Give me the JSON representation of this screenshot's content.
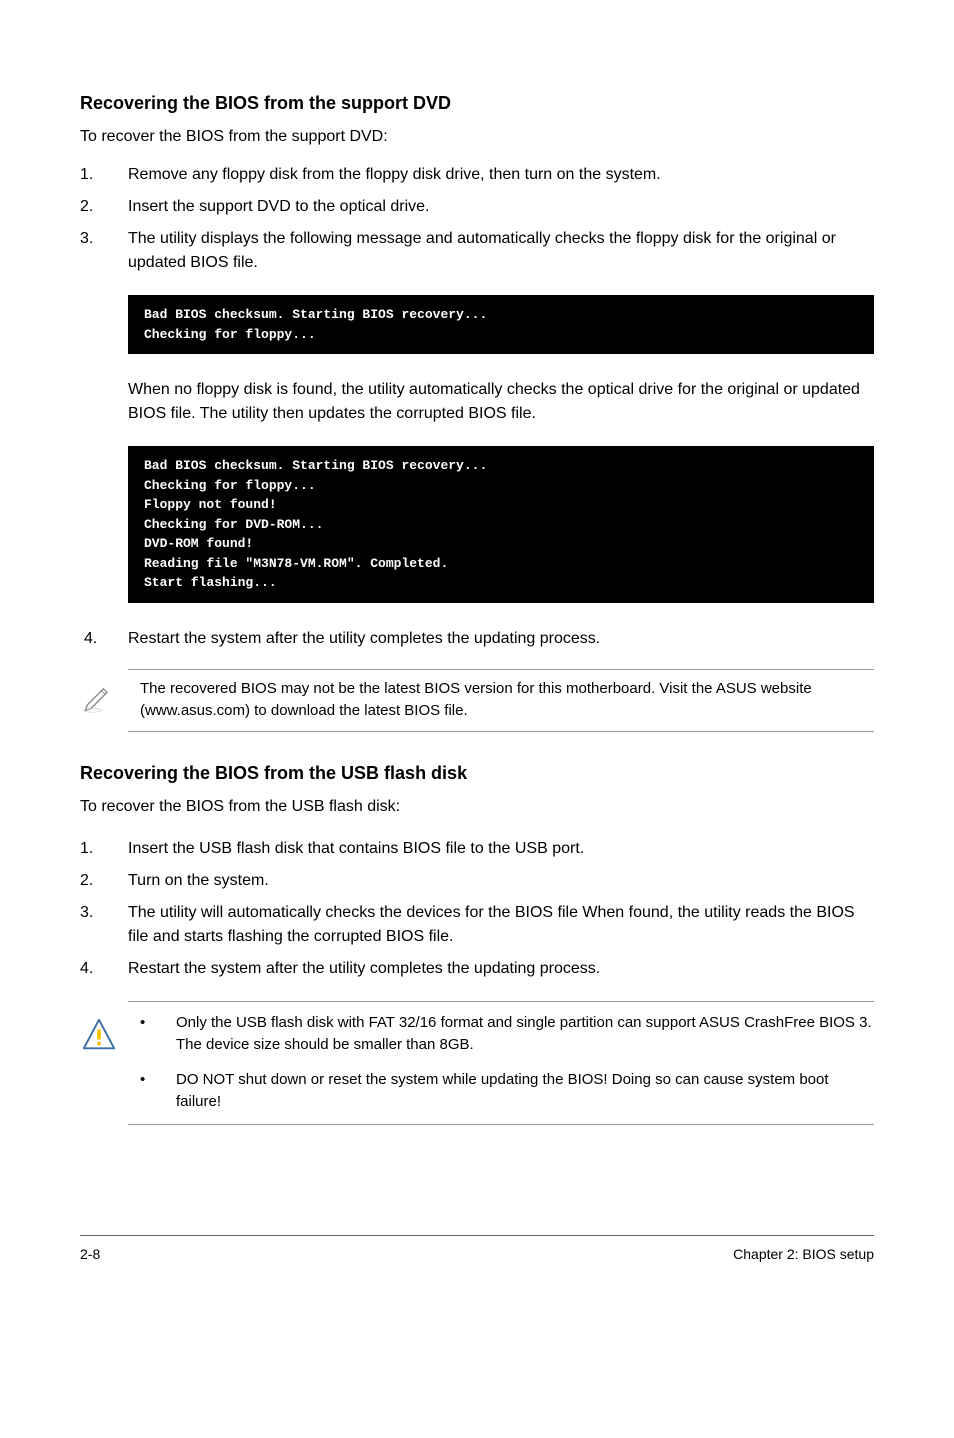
{
  "section1": {
    "heading": "Recovering the BIOS from the support DVD",
    "intro": "To recover the BIOS from the support DVD:",
    "steps": [
      {
        "num": "1.",
        "text": "Remove any floppy disk from the floppy disk drive, then turn on the system."
      },
      {
        "num": "2.",
        "text": "Insert the support DVD to the optical drive."
      },
      {
        "num": "3.",
        "text": "The utility displays the following message and automatically checks the floppy disk for the original or updated BIOS file."
      }
    ],
    "code1": "Bad BIOS checksum. Starting BIOS recovery...\nChecking for floppy...",
    "para1": "When no floppy disk is found, the utility automatically checks the optical drive for the original or updated BIOS file. The utility then updates the corrupted BIOS file.",
    "code2": "Bad BIOS checksum. Starting BIOS recovery...\nChecking for floppy...\nFloppy not found!\nChecking for DVD-ROM...\nDVD-ROM found!\nReading file \"M3N78-VM.ROM\". Completed.\nStart flashing...",
    "step4": {
      "num": "4.",
      "text": "Restart the system after the utility completes the updating process."
    },
    "note": "The recovered BIOS may not be the latest BIOS version for this motherboard. Visit the ASUS website (www.asus.com) to download the latest BIOS file."
  },
  "section2": {
    "heading": "Recovering the BIOS from the USB flash disk",
    "intro": "To recover the BIOS from the USB flash disk:",
    "steps": [
      {
        "num": "1.",
        "text": "Insert the USB flash disk that contains BIOS file to the USB port."
      },
      {
        "num": "2.",
        "text": "Turn on the system."
      },
      {
        "num": "3.",
        "text": "The utility will automatically checks the devices for the BIOS file When found, the utility reads the BIOS file and starts flashing the corrupted BIOS file."
      },
      {
        "num": "4.",
        "text": "Restart the system after the utility completes the updating process."
      }
    ],
    "warnings": [
      "Only the USB flash disk with FAT 32/16 format and single partition can support ASUS CrashFree BIOS 3. The device size should be smaller than 8GB.",
      "DO NOT shut down or reset the system while updating the BIOS! Doing so can cause system boot failure!"
    ]
  },
  "footer": {
    "left": "2-8",
    "right": "Chapter 2: BIOS setup"
  }
}
